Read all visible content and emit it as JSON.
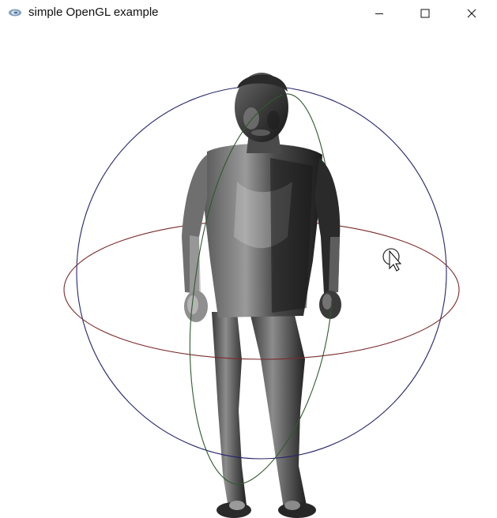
{
  "window": {
    "title": "simple OpenGL example",
    "icon": "opengl-app-icon",
    "controls": {
      "minimize_icon": "minimize-icon",
      "maximize_icon": "maximize-icon",
      "close_icon": "close-icon"
    }
  },
  "viewport": {
    "background": "#ffffff",
    "model": "human-figure-3d-model",
    "arcball": {
      "rings": [
        {
          "name": "x-axis-ring",
          "color": "#7a2a2a"
        },
        {
          "name": "y-axis-ring",
          "color": "#2f5a2f"
        },
        {
          "name": "z-axis-ring",
          "color": "#26266e"
        }
      ]
    },
    "cursor": "arrow-cursor-with-busy-ring-icon"
  }
}
